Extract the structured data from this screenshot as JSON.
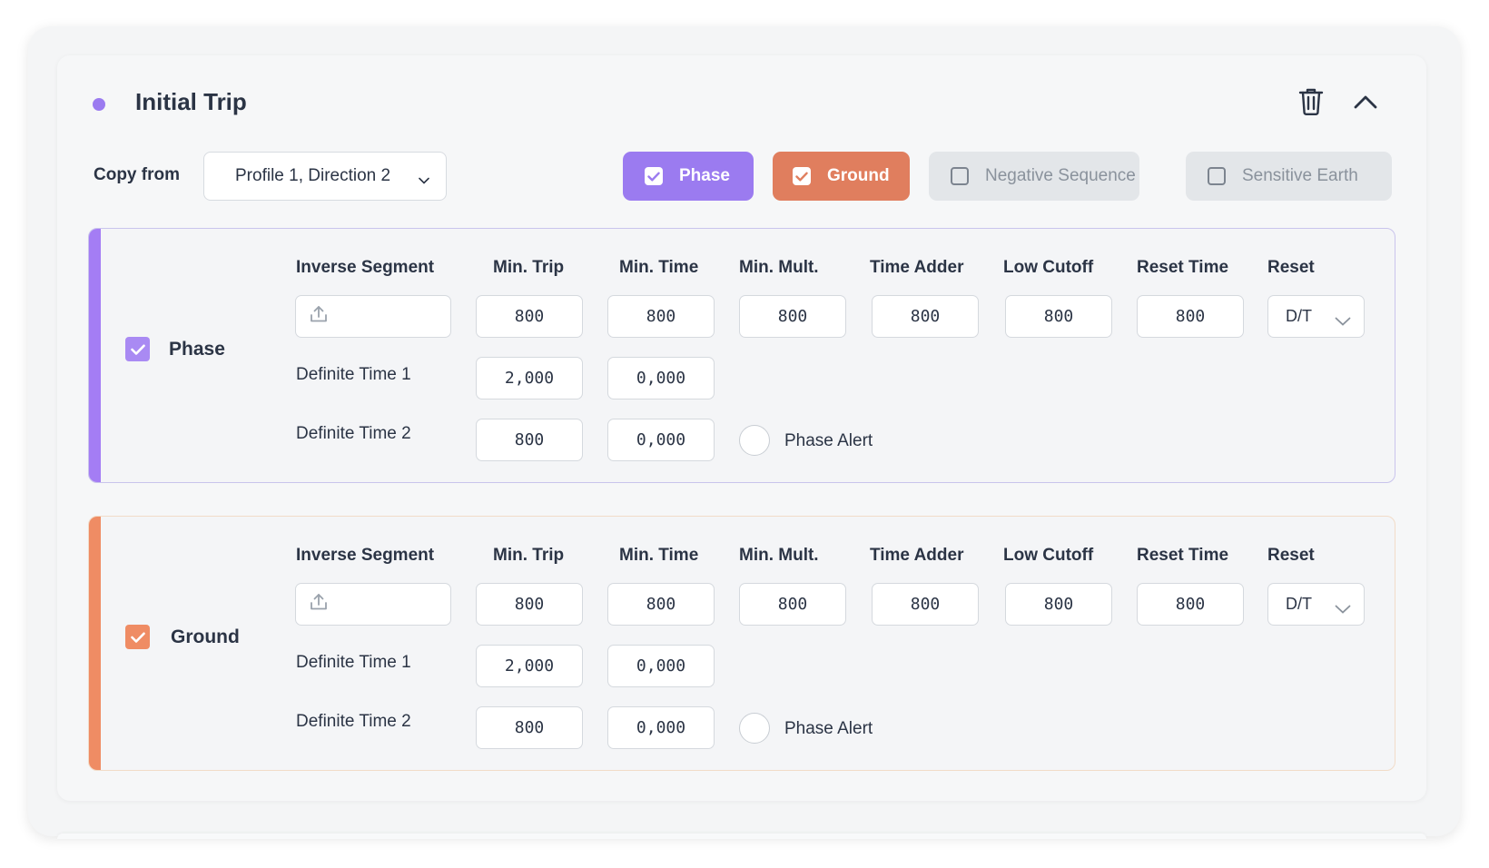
{
  "section": {
    "title": "Initial Trip",
    "dot_color": "#9b7bf0",
    "delete_icon": "trash-icon",
    "collapse_icon": "chevron-up-icon"
  },
  "copy_from": {
    "label": "Copy from",
    "selected": "Profile 1, Direction 2"
  },
  "toggles": [
    {
      "label": "Phase",
      "checked": true,
      "color": "#9b7bf0"
    },
    {
      "label": "Ground",
      "checked": true,
      "color": "#e07e5e"
    },
    {
      "label": "Negative Sequence",
      "checked": false
    },
    {
      "label": "Sensitive Earth",
      "checked": false
    }
  ],
  "columns": [
    "Inverse Segment",
    "Min. Trip",
    "Min. Time",
    "Min. Mult.",
    "Time Adder",
    "Low Cutoff",
    "Reset Time",
    "Reset"
  ],
  "panels": [
    {
      "name": "Phase",
      "checked": true,
      "accent": "#a47df4",
      "row1": {
        "min_trip": "800",
        "min_time": "800",
        "min_mult": "800",
        "time_adder": "800",
        "low_cutoff": "800",
        "reset_time": "800",
        "reset": "D/T"
      },
      "definite_time_1": {
        "label": "Definite Time 1",
        "min_trip": "2,000",
        "min_time": "0,000"
      },
      "definite_time_2": {
        "label": "Definite Time 2",
        "min_trip": "800",
        "min_time": "0,000"
      },
      "alert_label": "Phase Alert"
    },
    {
      "name": "Ground",
      "checked": true,
      "accent": "#ef8c64",
      "row1": {
        "min_trip": "800",
        "min_time": "800",
        "min_mult": "800",
        "time_adder": "800",
        "low_cutoff": "800",
        "reset_time": "800",
        "reset": "D/T"
      },
      "definite_time_1": {
        "label": "Definite Time 1",
        "min_trip": "2,000",
        "min_time": "0,000"
      },
      "definite_time_2": {
        "label": "Definite Time 2",
        "min_trip": "800",
        "min_time": "0,000"
      },
      "alert_label": "Phase Alert"
    }
  ]
}
